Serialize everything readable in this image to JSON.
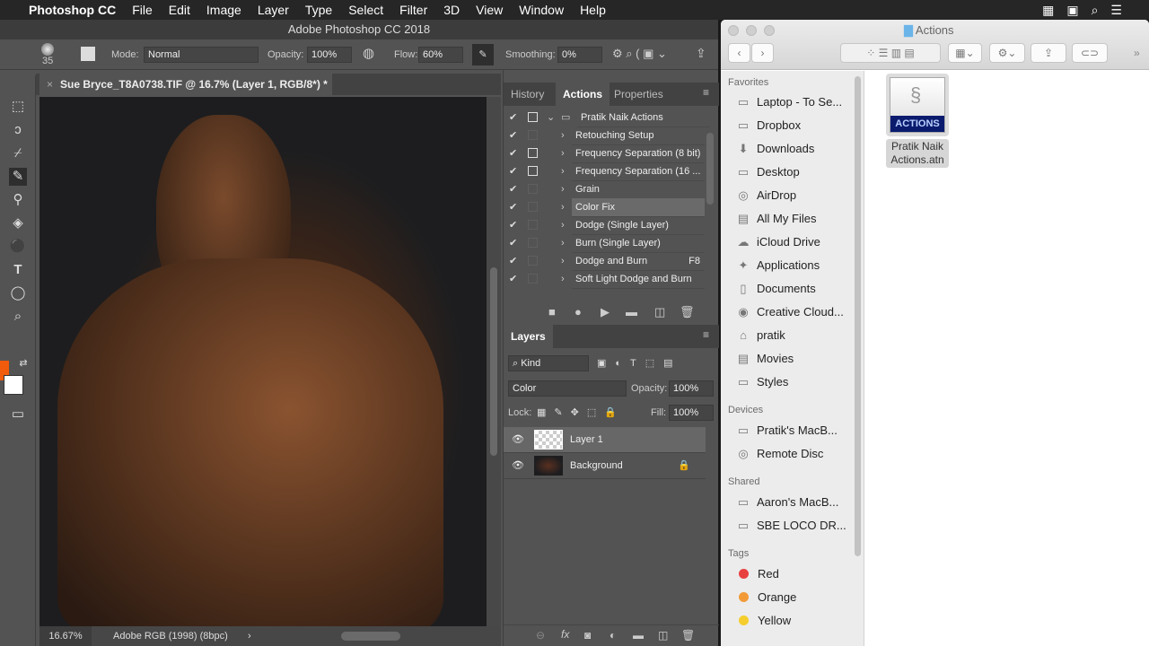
{
  "menubar": {
    "app": "Photoshop CC",
    "items": [
      "File",
      "Edit",
      "Image",
      "Layer",
      "Type",
      "Select",
      "Filter",
      "3D",
      "View",
      "Window",
      "Help"
    ]
  },
  "ps": {
    "title": "Adobe Photoshop CC 2018",
    "options": {
      "brush_size": "35",
      "mode_label": "Mode:",
      "mode": "Normal",
      "opacity_label": "Opacity:",
      "opacity": "100%",
      "flow_label": "Flow:",
      "flow": "60%",
      "smoothing_label": "Smoothing:",
      "smoothing": "0%"
    },
    "doc_tab": "Sue Bryce_T8A0738.TIF @ 16.7% (Layer 1, RGB/8*) *",
    "status": {
      "zoom": "16.67%",
      "profile": "Adobe RGB (1998) (8bpc)"
    },
    "colors": {
      "foreground": "#f25a0c",
      "background": "#ffffff"
    },
    "panel_tabs": [
      "History",
      "Actions",
      "Properties"
    ],
    "actions": [
      {
        "name": "Pratik Naik Actions",
        "dialog": true,
        "set": true
      },
      {
        "name": "Retouching Setup",
        "dialog": false
      },
      {
        "name": "Frequency Separation (8 bit)",
        "dialog": true
      },
      {
        "name": "Frequency Separation (16 ...",
        "dialog": true
      },
      {
        "name": "Grain",
        "dialog": false
      },
      {
        "name": "Color Fix",
        "dialog": false,
        "selected": true
      },
      {
        "name": "Dodge (Single Layer)",
        "dialog": false
      },
      {
        "name": "Burn (Single Layer)",
        "dialog": false
      },
      {
        "name": "Dodge and Burn",
        "dialog": false,
        "key": "F8"
      },
      {
        "name": "Soft Light Dodge and Burn",
        "dialog": false
      }
    ],
    "layers": {
      "title": "Layers",
      "filter": "Kind",
      "blend": "Color",
      "opacity_label": "Opacity:",
      "opacity": "100%",
      "lock_label": "Lock:",
      "fill_label": "Fill:",
      "fill": "100%",
      "items": [
        {
          "name": "Layer 1",
          "selected": true
        },
        {
          "name": "Background",
          "locked": true
        }
      ]
    }
  },
  "finder": {
    "title": "Actions",
    "favorites_label": "Favorites",
    "favorites": [
      [
        "folder",
        "Laptop - To Se..."
      ],
      [
        "folder",
        "Dropbox"
      ],
      [
        "download",
        "Downloads"
      ],
      [
        "desktop",
        "Desktop"
      ],
      [
        "airdrop",
        "AirDrop"
      ],
      [
        "files",
        "All My Files"
      ],
      [
        "cloud",
        "iCloud Drive"
      ],
      [
        "apps",
        "Applications"
      ],
      [
        "doc",
        "Documents"
      ],
      [
        "cc",
        "Creative Cloud..."
      ],
      [
        "home",
        "pratik"
      ],
      [
        "movie",
        "Movies"
      ],
      [
        "folder",
        "Styles"
      ]
    ],
    "devices_label": "Devices",
    "devices": [
      "Pratik's MacB...",
      "Remote Disc"
    ],
    "shared_label": "Shared",
    "shared": [
      "Aaron's MacB...",
      "SBE LOCO DR..."
    ],
    "tags_label": "Tags",
    "tags": [
      {
        "name": "Red",
        "color": "#e8423f"
      },
      {
        "name": "Orange",
        "color": "#f29a38"
      },
      {
        "name": "Yellow",
        "color": "#f5cd2e"
      }
    ],
    "file": {
      "badge": "ACTIONS",
      "name1": "Pratik Naik",
      "name2": "Actions.atn"
    }
  }
}
